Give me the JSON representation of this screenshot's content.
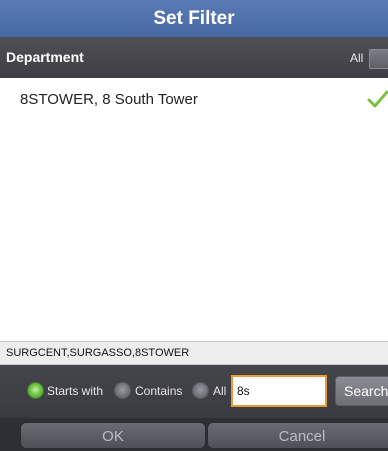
{
  "dialog": {
    "title": "Set Filter"
  },
  "department": {
    "label": "Department",
    "all_label": "All"
  },
  "list": {
    "items": [
      {
        "label": "8STOWER, 8 South Tower",
        "selected": true
      }
    ]
  },
  "summary": {
    "text": "SURGCENT,SURGASSO,8STOWER"
  },
  "search": {
    "options": [
      {
        "label": "Starts with",
        "selected": true
      },
      {
        "label": "Contains",
        "selected": false
      },
      {
        "label": "All",
        "selected": false
      }
    ],
    "value": "8s",
    "button_label": "Search"
  },
  "buttons": {
    "ok": "OK",
    "cancel": "Cancel"
  },
  "colors": {
    "title_bg": "#4f72ad",
    "check": "#7bc043",
    "input_border": "#e89a33"
  },
  "icons": {
    "selected": "check-icon"
  }
}
